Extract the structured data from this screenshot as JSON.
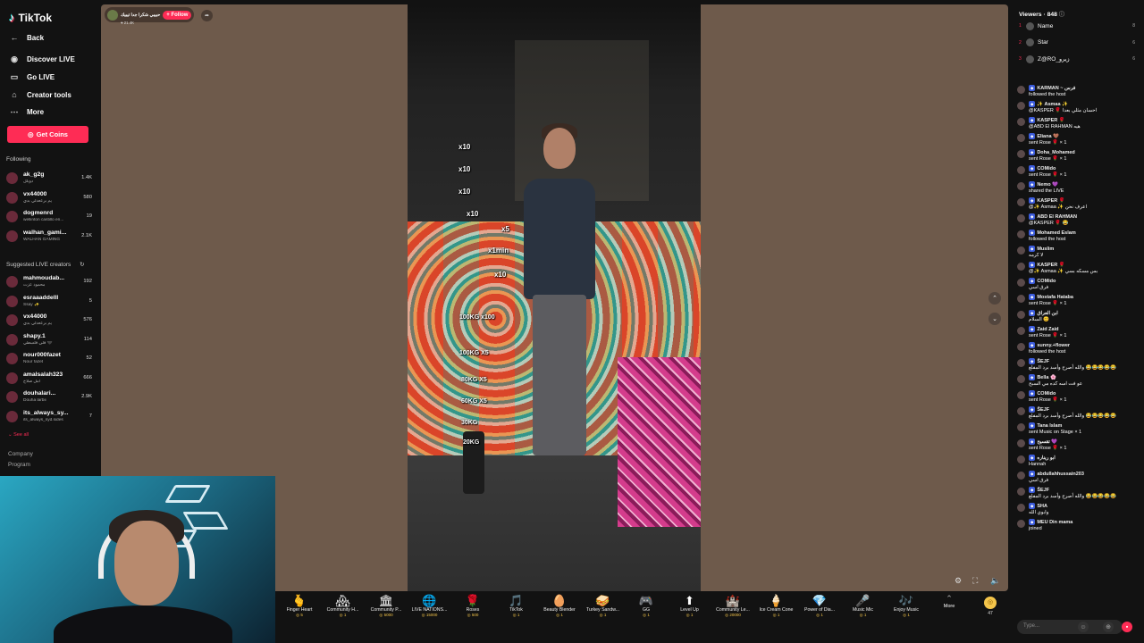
{
  "sidebar": {
    "logo": "TikTok",
    "nav": [
      {
        "label": "Back",
        "icon": "arrow-left-icon"
      },
      {
        "label": "Discover LIVE",
        "icon": "live-icon"
      },
      {
        "label": "Go LIVE",
        "icon": "camera-icon"
      },
      {
        "label": "Creator tools",
        "icon": "lightbulb-icon"
      },
      {
        "label": "More",
        "icon": "ellipsis-icon"
      }
    ],
    "get_coins": "Get Coins",
    "following_label": "Following",
    "following": [
      {
        "name": "ak_g2g",
        "sub": "دوبلل",
        "count": "1.4K"
      },
      {
        "name": "vx44000",
        "sub": "يم برععدلي بدي",
        "count": "580"
      },
      {
        "name": "dogmenrd",
        "sub": "wellinton castillo en...",
        "count": "19"
      },
      {
        "name": "walhan_gami...",
        "sub": "WALHAN GAMING",
        "count": "2.1K"
      }
    ],
    "suggested_label": "Suggested LIVE creators",
    "suggested": [
      {
        "name": "mahmoudab...",
        "sub": "محمود عزت",
        "count": "192"
      },
      {
        "name": "esraaaddelll",
        "sub": "Ssay ✨",
        "count": "5"
      },
      {
        "name": "vx44000",
        "sub": "يم برععدلي بدي",
        "count": "576"
      },
      {
        "name": "shapy.1",
        "sub": "فلي فلسطي 🖤",
        "count": "114"
      },
      {
        "name": "nour000fazet",
        "sub": "Nour fazet",
        "count": "52"
      },
      {
        "name": "amalsalah323",
        "sub": "امل صلاح",
        "count": "666"
      },
      {
        "name": "douhalari...",
        "sub": "Douha larbii",
        "count": "2.9K"
      },
      {
        "name": "its_always_sy...",
        "sub": "its_always_syd.sides",
        "count": "7"
      }
    ],
    "see_all": "See all",
    "footer": [
      "Company",
      "Program"
    ]
  },
  "stage": {
    "host_name": "حبيبي شكرا جدا تيبيك",
    "host_likes": "21.4K",
    "follow_label": "+ Follow",
    "gift_tags": [
      "x10",
      "x10",
      "x10",
      "x10",
      "x5",
      "x1min",
      "x10",
      "100KG x100",
      "100KG X5",
      "80KG X5",
      "60KG X5",
      "30KG",
      "20KG"
    ]
  },
  "gifts": [
    {
      "name": "Finger Heart",
      "price": "5",
      "icon": "🫰"
    },
    {
      "name": "Community H...",
      "price": "1",
      "icon": "🏘"
    },
    {
      "name": "Community P...",
      "price": "5000",
      "icon": "🏛"
    },
    {
      "name": "LIVE NATIONS...",
      "price": "15000",
      "icon": "🌐"
    },
    {
      "name": "Roses",
      "price": "500",
      "icon": "🌹"
    },
    {
      "name": "TikTok",
      "price": "1",
      "icon": "🎵"
    },
    {
      "name": "Beauty Blender",
      "price": "1",
      "icon": "🥚"
    },
    {
      "name": "Turkey Sandw...",
      "price": "1",
      "icon": "🥪"
    },
    {
      "name": "GG",
      "price": "1",
      "icon": "🎮"
    },
    {
      "name": "Level Up",
      "price": "1",
      "icon": "⬆"
    },
    {
      "name": "Community Le...",
      "price": "20000",
      "icon": "🏰"
    },
    {
      "name": "Ice Cream Cone",
      "price": "1",
      "icon": "🍦"
    },
    {
      "name": "Power of Dia...",
      "price": "1",
      "icon": "💎"
    },
    {
      "name": "Music Mic",
      "price": "1",
      "icon": "🎤"
    },
    {
      "name": "Enjoy Music",
      "price": "1",
      "icon": "🎶"
    }
  ],
  "more_label": "More",
  "coin_balance": "47",
  "panel": {
    "title": "Viewers · 848",
    "viewers": [
      {
        "rank": "1",
        "name": "Name",
        "score": "8"
      },
      {
        "rank": "2",
        "name": "Star",
        "score": "6"
      },
      {
        "rank": "3",
        "name": "Z@RO_زيرو",
        "score": "6"
      }
    ],
    "chat": [
      {
        "user": "KARMAN ~ فرس",
        "text": "followed the host"
      },
      {
        "user": "✨ Asmaa ✨",
        "text": "@KASPER 🌹 احسان مثلي بعدا"
      },
      {
        "user": "KASPER 🌹",
        "text": "@ABD El RAHMAN هيه"
      },
      {
        "user": "Eliana 🤎",
        "text": "sent Rose 🌹 × 1"
      },
      {
        "user": "Doha_Mohamed",
        "text": "sent Rose 🌹 × 1"
      },
      {
        "user": "COMido",
        "text": "sent Rose 🌹 × 1"
      },
      {
        "user": "Nemo 💜",
        "text": "shared the LIVE"
      },
      {
        "user": "KASPER 🌹",
        "text": "@✨ Asmaa ✨ اعرف نحن"
      },
      {
        "user": "ABD El RAHMAN",
        "text": "@KASPER 🌹 😂"
      },
      {
        "user": "Mohamed Eslam",
        "text": "followed the host"
      },
      {
        "user": "Muslim",
        "text": "لا كرمه"
      },
      {
        "user": "KASPER 🌹",
        "text": "@✨ Asmaa ✨ بس مسكه بسي"
      },
      {
        "user": "COMido",
        "text": "فرق اسي"
      },
      {
        "user": "Mostafa Hataba",
        "text": "sent Rose 🌹 × 1"
      },
      {
        "user": "ابن العراق",
        "text": "السلام 😊"
      },
      {
        "user": "Zaid Zaid",
        "text": "sent Rose 🌹 × 1"
      },
      {
        "user": "sunny.+flower",
        "text": "followed the host"
      },
      {
        "user": "ŠEJF",
        "text": "والله أصرح وأسد برد المفلع 😂😂😂😂😂"
      },
      {
        "user": "Bella 🌸",
        "text": "عو فت اسه كده مي السبح"
      },
      {
        "user": "COMido",
        "text": "sent Rose 🌹 × 1"
      },
      {
        "user": "ŠEJF",
        "text": "والله أصرح وأسد برد المفلع 😂😂😂😂😂"
      },
      {
        "user": "Tana Islam",
        "text": "sent Music on Stage × 1"
      },
      {
        "user": "تقسيح 💜",
        "text": "sent Rose 🌹 × 1"
      },
      {
        "user": "ابو ريناره",
        "text": "Hannah"
      },
      {
        "user": "abdullahhussain203",
        "text": "فرق اسي"
      },
      {
        "user": "ŠEJF",
        "text": "والله أصرح وأسد برد المفلع 😂😂😂😂😂"
      },
      {
        "user": "SHA",
        "text": "وابوي الله"
      },
      {
        "user": "MEU Din mama",
        "text": "joined"
      }
    ],
    "input_placeholder": "Type..."
  }
}
